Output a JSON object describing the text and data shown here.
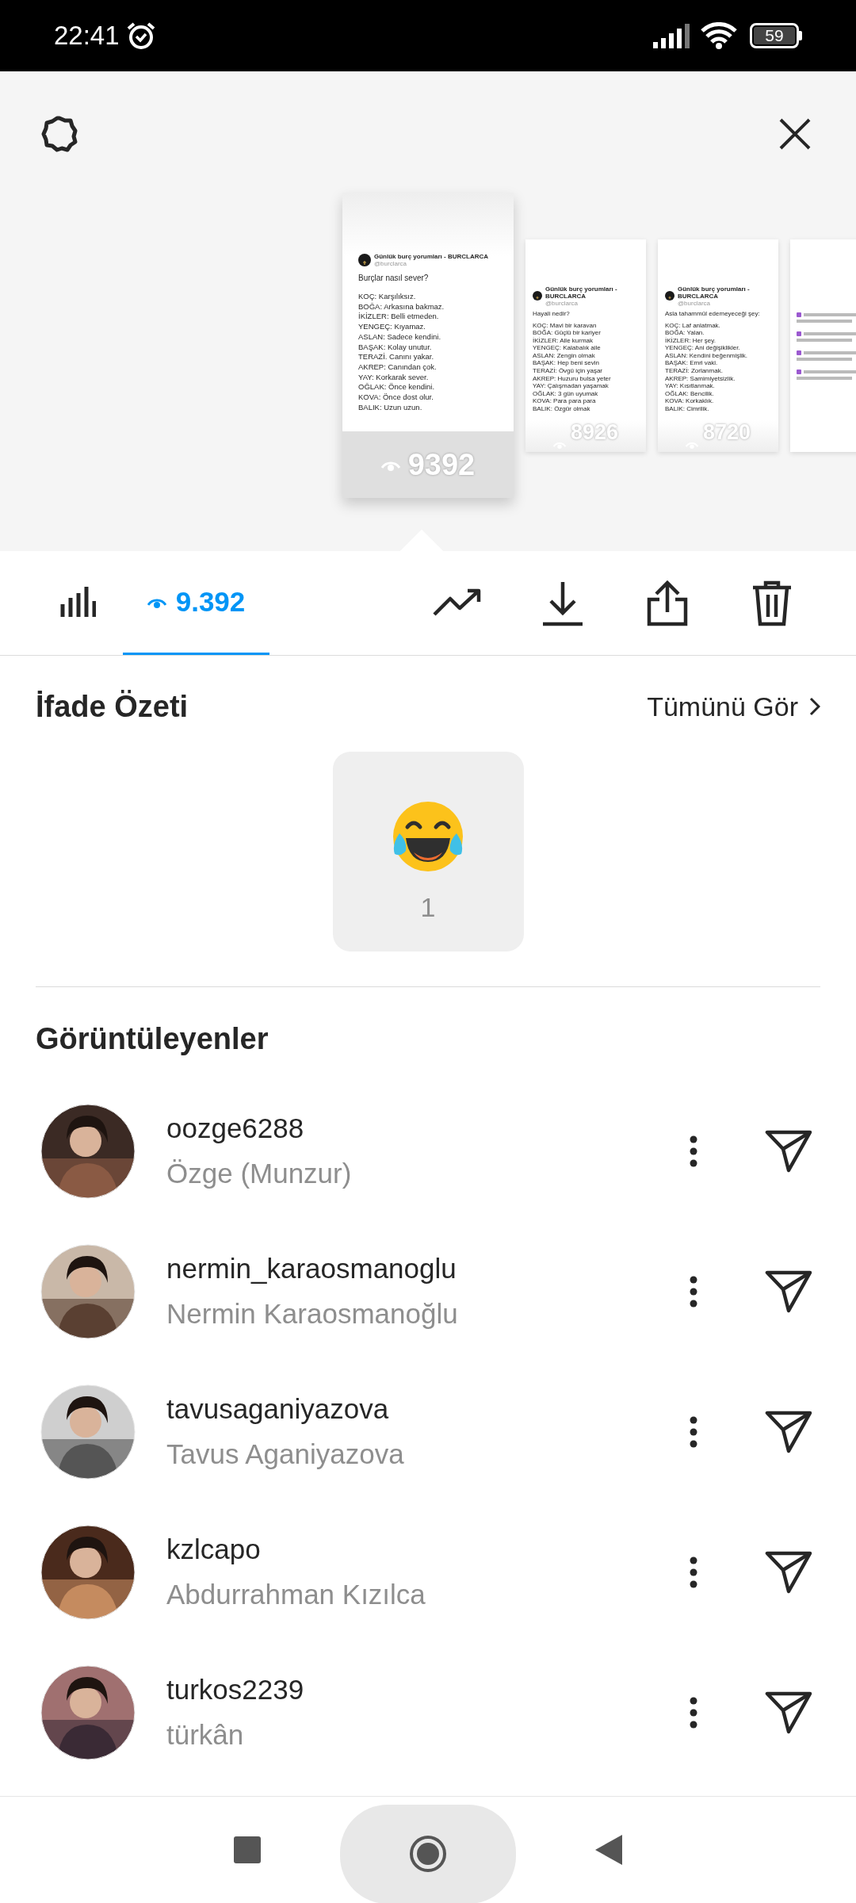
{
  "status_bar": {
    "time": "22:41",
    "battery": "59"
  },
  "stories": [
    {
      "selected": true,
      "author": "Günlük burç yorumları - BURCLARCA",
      "handle": "@burclarca",
      "title": "Burçlar nasıl sever?",
      "lines": [
        "KOÇ: Karşılıksız.",
        "BOĞA: Arkasına bakmaz.",
        "İKİZLER: Belli etmeden.",
        "YENGEÇ: Kıyamaz.",
        "ASLAN: Sadece kendini.",
        "BAŞAK: Kolay unutur.",
        "TERAZİ. Canını yakar.",
        "AKREP: Canından çok.",
        "YAY: Korkarak sever.",
        "OĞLAK: Önce kendini.",
        "KOVA: Önce dost olur.",
        "BALIK: Uzun uzun."
      ],
      "views": "9392"
    },
    {
      "selected": false,
      "author": "Günlük burç yorumları - BURCLARCA",
      "handle": "@burclarca",
      "title": "Hayali nedir?",
      "lines": [
        "KOÇ: Mavi bir karavan",
        "BOĞA: Güçlü bir kariyer",
        "İKİZLER: Aile kurmak",
        "YENGEÇ: Kalabalık aile",
        "ASLAN: Zengin olmak",
        "BAŞAK: Hep beni sevin",
        "TERAZİ: Övgü için yaşar",
        "AKREP: Huzuru bulsa yeter",
        "YAY: Çalışmadan yaşamak",
        "OĞLAK: 3 gün uyumak",
        "KOVA: Para para para",
        "BALIK: Özgür olmak"
      ],
      "views": "8926"
    },
    {
      "selected": false,
      "author": "Günlük burç yorumları - BURCLARCA",
      "handle": "@burclarca",
      "title": "Asla tahammül edemeyeceği şey:",
      "lines": [
        "KOÇ: Laf anlatmak.",
        "BOĞA: Yalan.",
        "İKİZLER: Her şey.",
        "YENGEÇ: Ani değişiklikler.",
        "ASLAN: Kendini beğenmişlik.",
        "BAŞAK: Emri vaki.",
        "TERAZİ: Zorlanmak.",
        "AKREP: Samimiyetsizlik.",
        "YAY: Kısıtlanmak.",
        "OĞLAK: Bencilik.",
        "KOVA: Korkaklık.",
        "BALIK: Cimrilik."
      ],
      "views": "8720"
    },
    {
      "selected": false,
      "kind": "cut"
    }
  ],
  "tabs": [
    {
      "kind": "insights",
      "selected": false
    },
    {
      "kind": "views",
      "label": "9.392",
      "selected": true
    }
  ],
  "actions": [
    {
      "kind": "trend"
    },
    {
      "kind": "download"
    },
    {
      "kind": "share"
    },
    {
      "kind": "delete"
    }
  ],
  "reactions": {
    "title": "İfade Özeti",
    "see_all": "Tümünü Gör",
    "items": [
      {
        "kind": "laugh",
        "count": "1"
      }
    ]
  },
  "viewers": {
    "title": "Görüntüleyenler",
    "items": [
      {
        "username": "oozge6288",
        "name": "Özge (Munzur)"
      },
      {
        "username": "nermin_karaosmanoglu",
        "name": "Nermin Karaosmanoğlu"
      },
      {
        "username": "tavusaganiyazova",
        "name": "Tavus Aganiyazova"
      },
      {
        "username": "kzlcapo",
        "name": "Abdurrahman Kızılca"
      },
      {
        "username": "turkos2239",
        "name": "türkân"
      }
    ]
  },
  "nav_bar": [
    {
      "kind": "recents"
    },
    {
      "kind": "home"
    },
    {
      "kind": "back"
    }
  ]
}
